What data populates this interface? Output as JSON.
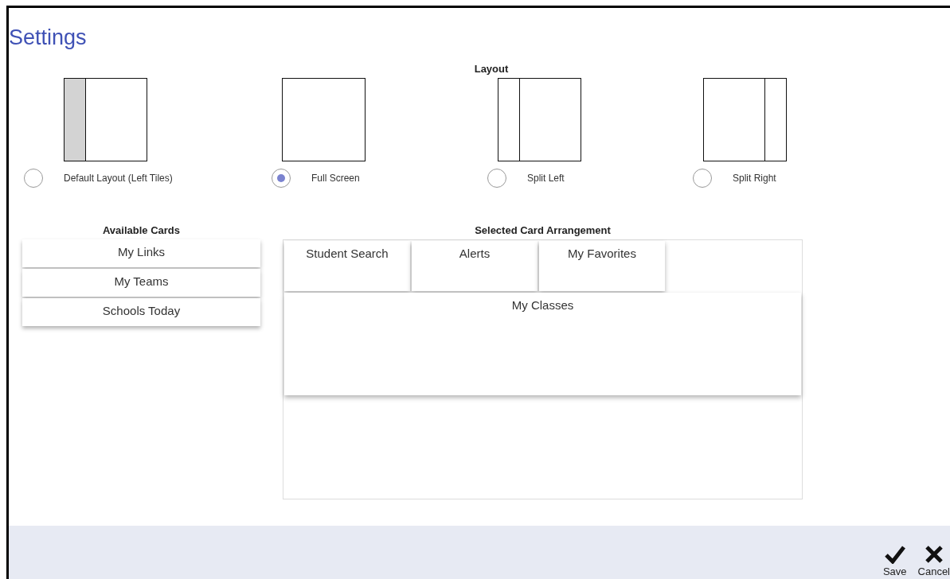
{
  "title": "Settings",
  "layout": {
    "heading": "Layout",
    "options": [
      {
        "label": "Default Layout (Left Tiles)",
        "kind": "left-tiles",
        "selected": false
      },
      {
        "label": "Full Screen",
        "kind": "full",
        "selected": true
      },
      {
        "label": "Split Left",
        "kind": "split-left",
        "selected": false
      },
      {
        "label": "Split Right",
        "kind": "split-right",
        "selected": false
      }
    ]
  },
  "available_cards": {
    "heading": "Available Cards",
    "items": [
      "My Links",
      "My Teams",
      "Schools Today"
    ]
  },
  "selected_arrangement": {
    "heading": "Selected Card Arrangement",
    "cards": [
      {
        "label": "Student Search",
        "kind": "tile"
      },
      {
        "label": "Alerts",
        "kind": "tile"
      },
      {
        "label": "My Favorites",
        "kind": "tile"
      },
      {
        "label": "My Classes",
        "kind": "wide"
      }
    ]
  },
  "footer": {
    "buttons": [
      {
        "label": "Save",
        "kind": "save"
      },
      {
        "label": "Cancel",
        "kind": "cancel"
      }
    ]
  }
}
